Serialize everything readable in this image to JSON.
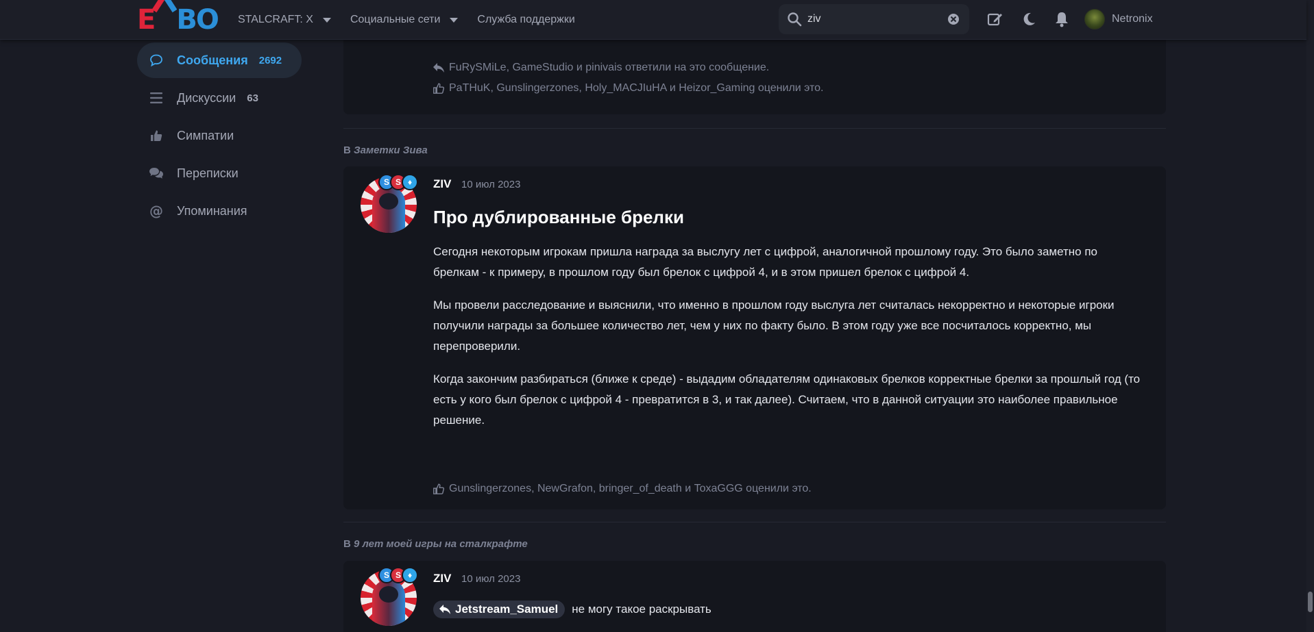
{
  "colors": {
    "accent": "#3fa8f0",
    "brand_red": "#e0243a",
    "brand_blue": "#2b8fd8",
    "background": "#191b24",
    "card": "#14161d"
  },
  "header": {
    "logo": "EXBO",
    "nav": [
      {
        "label": "STALCRAFT: X",
        "dropdown": true
      },
      {
        "label": "Социальные сети",
        "dropdown": true
      },
      {
        "label": "Служба поддержки",
        "dropdown": false
      }
    ],
    "search": {
      "value": "ziv",
      "icon": "search-icon"
    },
    "icons": [
      "edit-icon",
      "moon-icon",
      "bell-icon"
    ],
    "user": {
      "name": "Netronix"
    }
  },
  "sidebar": {
    "items": [
      {
        "label": "Сообщения",
        "count": "2692",
        "icon": "chat-bubble-icon",
        "active": true
      },
      {
        "label": "Дискуссии",
        "count": "63",
        "icon": "list-icon",
        "active": false
      },
      {
        "label": "Симпатии",
        "count": "",
        "icon": "thumbs-up-icon",
        "active": false
      },
      {
        "label": "Переписки",
        "count": "",
        "icon": "conversations-icon",
        "active": false
      },
      {
        "label": "Упоминания",
        "count": "",
        "icon": "at-icon",
        "active": false
      }
    ]
  },
  "posts": [
    {
      "replies": "FuRySMiLe, GameStudio и pinivais ответили на это сообщение.",
      "likes": "PaTHuK, Gunslingerzones, Holy_MACJIuHA и Heizor_Gaming оценили это."
    },
    {
      "context_prefix": "В",
      "context_thread": "Заметки Зива",
      "author": "ZIV",
      "date": "10 июл 2023",
      "badges": [
        "S",
        "S",
        "♦"
      ],
      "title": "Про дублированные брелки",
      "paragraphs": [
        "Сегодня некоторым игрокам пришла награда за выслугу лет с цифрой, аналогичной прошлому году. Это было заметно по брелкам - к примеру, в прошлом году был брелок с цифрой 4, и в этом пришел брелок с цифрой 4.",
        "Мы провели расследование и выяснили, что именно в прошлом году выслуга лет считалась некорректно и некоторые игроки получили награды за большее количество лет, чем у них по факту было. В этом году уже все посчиталось корректно, мы перепроверили.",
        "Когда закончим разбираться (ближе к среде) - выдадим обладателям одинаковых брелков корректные брелки за прошлый год (то есть у кого был брелок с цифрой 4 - превратится в 3, и так далее). Считаем, что в данной ситуации это наиболее правильное решение."
      ],
      "likes": "Gunslingerzones, NewGrafon, bringer_of_death и ToxaGGG оценили это."
    },
    {
      "context_prefix": "В",
      "context_thread": "9 лет моей игры на сталкрафте",
      "author": "ZIV",
      "date": "10 июл 2023",
      "badges": [
        "S",
        "S",
        "♦"
      ],
      "quote_user": "Jetstream_Samuel",
      "text": "не могу такое раскрывать"
    }
  ]
}
